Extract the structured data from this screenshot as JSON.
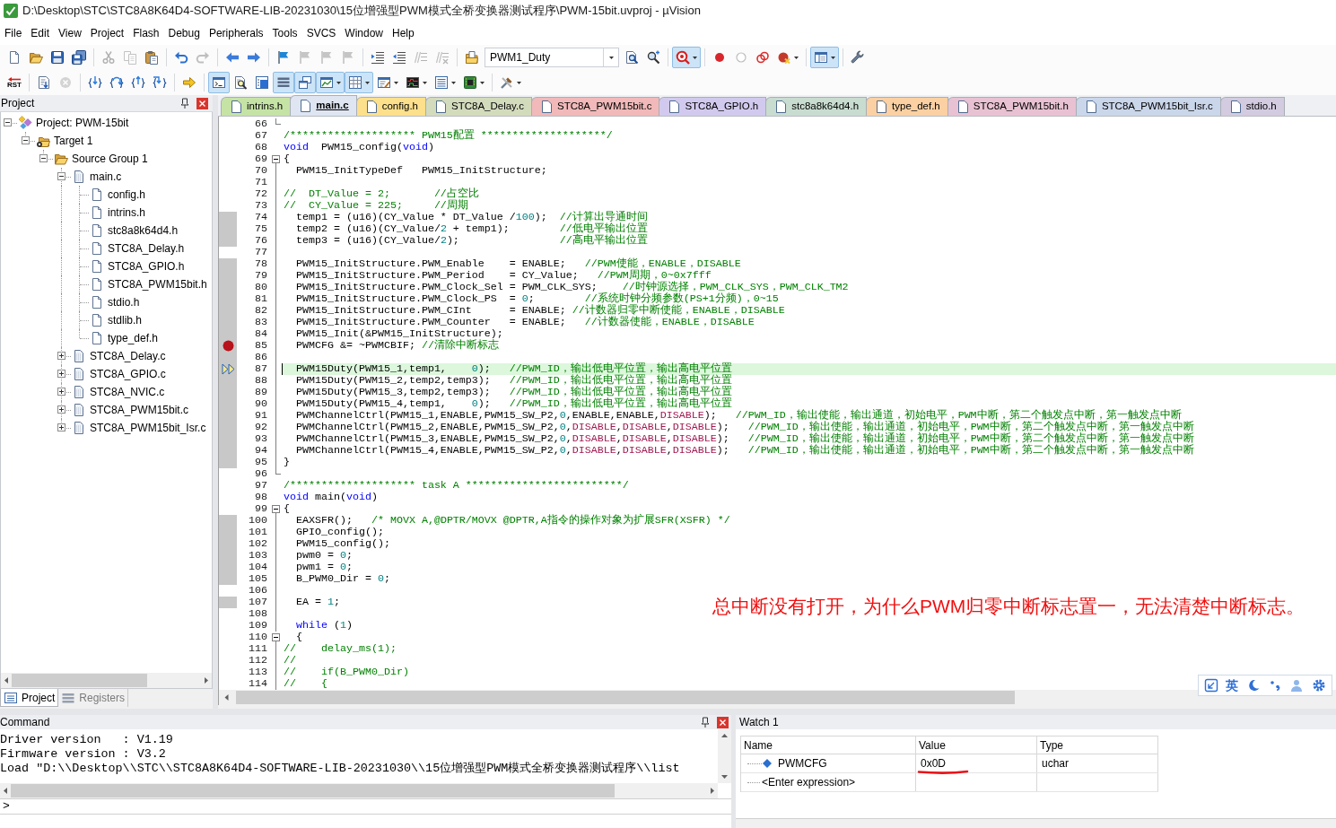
{
  "window": {
    "title": "D:\\Desktop\\STC\\STC8A8K64D4-SOFTWARE-LIB-20231030\\15位增强型PWM模式全桥变换器测试程序\\PWM-15bit.uvproj - µVision"
  },
  "menu": [
    "File",
    "Edit",
    "View",
    "Project",
    "Flash",
    "Debug",
    "Peripherals",
    "Tools",
    "SVCS",
    "Window",
    "Help"
  ],
  "toolbars": [
    {
      "groups": [
        [
          {
            "kind": "button",
            "pressed": false,
            "disabled": false,
            "dropdown": false
          },
          {
            "kind": "button",
            "pressed": false,
            "disabled": false,
            "dropdown": false
          },
          {
            "kind": "button",
            "pressed": false,
            "disabled": false,
            "dropdown": false
          },
          {
            "kind": "button",
            "pressed": false,
            "disabled": false,
            "dropdown": false
          }
        ],
        [
          {
            "kind": "button",
            "pressed": false,
            "disabled": true,
            "dropdown": false
          },
          {
            "kind": "button",
            "pressed": false,
            "disabled": true,
            "dropdown": false
          },
          {
            "kind": "button",
            "pressed": false,
            "disabled": false,
            "dropdown": false
          }
        ],
        [
          {
            "kind": "button",
            "pressed": false,
            "disabled": false,
            "dropdown": false
          },
          {
            "kind": "button",
            "pressed": false,
            "disabled": true,
            "dropdown": false
          }
        ],
        [
          {
            "kind": "button",
            "pressed": false,
            "disabled": false,
            "dropdown": false
          },
          {
            "kind": "button",
            "pressed": false,
            "disabled": false,
            "dropdown": false
          }
        ],
        [
          {
            "kind": "button",
            "pressed": false,
            "disabled": false,
            "dropdown": false
          },
          {
            "kind": "button",
            "pressed": false,
            "disabled": true,
            "dropdown": false
          },
          {
            "kind": "button",
            "pressed": false,
            "disabled": true,
            "dropdown": false
          },
          {
            "kind": "button",
            "pressed": false,
            "disabled": true,
            "dropdown": false
          }
        ],
        [
          {
            "kind": "button",
            "pressed": false,
            "disabled": false,
            "dropdown": false
          },
          {
            "kind": "button",
            "pressed": false,
            "disabled": false,
            "dropdown": false
          },
          {
            "kind": "button",
            "pressed": false,
            "disabled": true,
            "dropdown": false
          },
          {
            "kind": "button",
            "pressed": false,
            "disabled": true,
            "dropdown": false
          }
        ],
        [
          {
            "kind": "button",
            "pressed": false,
            "disabled": false,
            "dropdown": false
          },
          {
            "kind": "combo",
            "value": "PWM1_Duty"
          },
          {
            "kind": "button",
            "pressed": false,
            "disabled": false,
            "dropdown": false
          },
          {
            "kind": "button",
            "pressed": false,
            "disabled": false,
            "dropdown": false
          }
        ],
        [
          {
            "kind": "button",
            "pressed": true,
            "disabled": false,
            "dropdown": true
          }
        ],
        [
          {
            "kind": "button",
            "pressed": false,
            "disabled": false,
            "dropdown": false
          },
          {
            "kind": "button",
            "pressed": false,
            "disabled": false,
            "dropdown": false
          },
          {
            "kind": "button",
            "pressed": false,
            "disabled": false,
            "dropdown": false
          },
          {
            "kind": "button",
            "pressed": false,
            "disabled": false,
            "dropdown": true
          }
        ],
        [
          {
            "kind": "button",
            "pressed": true,
            "disabled": false,
            "dropdown": true
          }
        ],
        [
          {
            "kind": "button",
            "pressed": false,
            "disabled": false,
            "dropdown": false
          }
        ]
      ]
    },
    {
      "groups": [
        [
          {
            "kind": "button",
            "label": "RST",
            "pressed": false,
            "disabled": false,
            "dropdown": false
          }
        ],
        [
          {
            "kind": "button",
            "pressed": false,
            "disabled": false,
            "dropdown": false
          },
          {
            "kind": "button",
            "pressed": false,
            "disabled": true,
            "dropdown": false
          }
        ],
        [
          {
            "kind": "button",
            "pressed": false,
            "disabled": false,
            "dropdown": false
          },
          {
            "kind": "button",
            "pressed": false,
            "disabled": false,
            "dropdown": false
          },
          {
            "kind": "button",
            "pressed": false,
            "disabled": false,
            "dropdown": false
          },
          {
            "kind": "button",
            "pressed": false,
            "disabled": false,
            "dropdown": false
          }
        ],
        [
          {
            "kind": "button",
            "pressed": false,
            "disabled": false,
            "dropdown": false
          }
        ],
        [
          {
            "kind": "button",
            "pressed": true,
            "disabled": false,
            "dropdown": false
          },
          {
            "kind": "button",
            "pressed": false,
            "disabled": false,
            "dropdown": false
          },
          {
            "kind": "button",
            "pressed": false,
            "disabled": false,
            "dropdown": false
          },
          {
            "kind": "button",
            "pressed": true,
            "disabled": false,
            "dropdown": false
          },
          {
            "kind": "button",
            "pressed": true,
            "disabled": false,
            "dropdown": false
          },
          {
            "kind": "button",
            "pressed": true,
            "disabled": false,
            "dropdown": true
          },
          {
            "kind": "button",
            "pressed": true,
            "disabled": false,
            "dropdown": true
          },
          {
            "kind": "button",
            "pressed": false,
            "disabled": false,
            "dropdown": true
          },
          {
            "kind": "button",
            "pressed": false,
            "disabled": false,
            "dropdown": true
          },
          {
            "kind": "button",
            "pressed": false,
            "disabled": false,
            "dropdown": true
          },
          {
            "kind": "button",
            "pressed": false,
            "disabled": false,
            "dropdown": true
          }
        ],
        [
          {
            "kind": "button",
            "pressed": false,
            "disabled": false,
            "dropdown": true
          }
        ]
      ]
    }
  ],
  "project_panel": {
    "title": "Project",
    "tree": [
      {
        "label": "Project: PWM-15bit",
        "kind": "project",
        "expanded": true,
        "children": [
          {
            "label": "Target 1",
            "kind": "target",
            "expanded": true,
            "children": [
              {
                "label": "Source Group 1",
                "kind": "group",
                "expanded": true,
                "children": [
                  {
                    "label": "main.c",
                    "kind": "source",
                    "expanded": true,
                    "children": [
                      {
                        "label": "config.h",
                        "kind": "header"
                      },
                      {
                        "label": "intrins.h",
                        "kind": "header"
                      },
                      {
                        "label": "stc8a8k64d4.h",
                        "kind": "header"
                      },
                      {
                        "label": "STC8A_Delay.h",
                        "kind": "header"
                      },
                      {
                        "label": "STC8A_GPIO.h",
                        "kind": "header"
                      },
                      {
                        "label": "STC8A_PWM15bit.h",
                        "kind": "header"
                      },
                      {
                        "label": "stdio.h",
                        "kind": "header"
                      },
                      {
                        "label": "stdlib.h",
                        "kind": "header"
                      },
                      {
                        "label": "type_def.h",
                        "kind": "header"
                      }
                    ]
                  },
                  {
                    "label": "STC8A_Delay.c",
                    "kind": "source",
                    "expanded": false
                  },
                  {
                    "label": "STC8A_GPIO.c",
                    "kind": "source",
                    "expanded": false
                  },
                  {
                    "label": "STC8A_NVIC.c",
                    "kind": "source",
                    "expanded": false
                  },
                  {
                    "label": "STC8A_PWM15bit.c",
                    "kind": "source",
                    "expanded": false
                  },
                  {
                    "label": "STC8A_PWM15bit_Isr.c",
                    "kind": "source",
                    "expanded": false
                  }
                ]
              }
            ]
          }
        ]
      }
    ],
    "tabs": [
      {
        "label": "Project",
        "selected": true
      },
      {
        "label": "Registers",
        "selected": false
      }
    ]
  },
  "editor": {
    "tabs": [
      {
        "label": "intrins.h",
        "color": "#c6e3a6",
        "selected": false
      },
      {
        "label": "main.c",
        "color": "#dfe6f2",
        "selected": true
      },
      {
        "label": "config.h",
        "color": "#fde08c",
        "selected": false
      },
      {
        "label": "STC8A_Delay.c",
        "color": "#d3dbbd",
        "selected": false
      },
      {
        "label": "STC8A_PWM15bit.c",
        "color": "#f1b9b9",
        "selected": false
      },
      {
        "label": "STC8A_GPIO.h",
        "color": "#d2caee",
        "selected": false
      },
      {
        "label": "stc8a8k64d4.h",
        "color": "#c8ddd0",
        "selected": false
      },
      {
        "label": "type_def.h",
        "color": "#fbd0a2",
        "selected": false
      },
      {
        "label": "STC8A_PWM15bit.h",
        "color": "#e8c2d2",
        "selected": false
      },
      {
        "label": "STC8A_PWM15bit_Isr.c",
        "color": "#cad6ea",
        "selected": false
      },
      {
        "label": "stdio.h",
        "color": "#d3cbe0",
        "selected": false
      }
    ],
    "lines": [
      {
        "number": "66",
        "kind": "end",
        "executable": false,
        "breakpoint": false,
        "current": false,
        "caret": false
      },
      {
        "number": "67",
        "kind": "plain",
        "executable": false,
        "breakpoint": false,
        "current": false,
        "caret": false,
        "code": [
          {
            "text": "/******************** PWM15配置 ********************/",
            "kind": "comment"
          }
        ]
      },
      {
        "number": "68",
        "kind": "plain",
        "executable": false,
        "breakpoint": false,
        "current": false,
        "caret": false,
        "code": [
          {
            "text": "void",
            "kind": "keyword"
          },
          {
            "text": "  PWM15_config(",
            "kind": "plain"
          },
          {
            "text": "void",
            "kind": "keyword"
          },
          {
            "text": ")",
            "kind": "plain"
          }
        ]
      },
      {
        "number": "69",
        "kind": "start",
        "executable": false,
        "breakpoint": false,
        "current": false,
        "caret": false,
        "code": [
          {
            "text": "{",
            "kind": "plain"
          }
        ]
      },
      {
        "number": "70",
        "kind": "body",
        "executable": false,
        "breakpoint": false,
        "current": false,
        "caret": false,
        "code": [
          {
            "text": "  PWM15_InitTypeDef   PWM15_InitStructure;",
            "kind": "plain"
          }
        ]
      },
      {
        "number": "71",
        "kind": "body",
        "executable": false,
        "breakpoint": false,
        "current": false,
        "caret": false
      },
      {
        "number": "72",
        "kind": "body",
        "executable": false,
        "breakpoint": false,
        "current": false,
        "caret": false,
        "code": [
          {
            "text": "//  DT_Value = 2;       //占空比",
            "kind": "comment"
          }
        ]
      },
      {
        "number": "73",
        "kind": "body",
        "executable": false,
        "breakpoint": false,
        "current": false,
        "caret": false,
        "code": [
          {
            "text": "//  CY_Value = 225;     //周期",
            "kind": "comment"
          }
        ]
      },
      {
        "number": "74",
        "kind": "body",
        "executable": true,
        "breakpoint": false,
        "current": false,
        "caret": false,
        "code": [
          {
            "text": "  temp1 = (u16)(CY_Value * DT_Value /",
            "kind": "plain"
          },
          {
            "text": "100",
            "kind": "number"
          },
          {
            "text": ");  ",
            "kind": "plain"
          },
          {
            "text": "//计算出导通时间",
            "kind": "comment"
          }
        ]
      },
      {
        "number": "75",
        "kind": "body",
        "executable": true,
        "breakpoint": false,
        "current": false,
        "caret": false,
        "code": [
          {
            "text": "  temp2 = (u16)(CY_Value/",
            "kind": "plain"
          },
          {
            "text": "2",
            "kind": "number"
          },
          {
            "text": " + temp1);        ",
            "kind": "plain"
          },
          {
            "text": "//低电平输出位置",
            "kind": "comment"
          }
        ]
      },
      {
        "number": "76",
        "kind": "body",
        "executable": true,
        "breakpoint": false,
        "current": false,
        "caret": false,
        "code": [
          {
            "text": "  temp3 = (u16)(CY_Value/",
            "kind": "plain"
          },
          {
            "text": "2",
            "kind": "number"
          },
          {
            "text": ");                ",
            "kind": "plain"
          },
          {
            "text": "//高电平输出位置",
            "kind": "comment"
          }
        ]
      },
      {
        "number": "77",
        "kind": "body",
        "executable": false,
        "breakpoint": false,
        "current": false,
        "caret": false
      },
      {
        "number": "78",
        "kind": "body",
        "executable": true,
        "breakpoint": false,
        "current": false,
        "caret": false,
        "code": [
          {
            "text": "  PWM15_InitStructure.PWM_Enable    = ENABLE;   ",
            "kind": "plain"
          },
          {
            "text": "//PWM使能，ENABLE，DISABLE",
            "kind": "comment"
          }
        ]
      },
      {
        "number": "79",
        "kind": "body",
        "executable": true,
        "breakpoint": false,
        "current": false,
        "caret": false,
        "code": [
          {
            "text": "  PWM15_InitStructure.PWM_Period    = CY_Value;   ",
            "kind": "plain"
          },
          {
            "text": "//PWM周期，0~0x7fff",
            "kind": "comment"
          }
        ]
      },
      {
        "number": "80",
        "kind": "body",
        "executable": true,
        "breakpoint": false,
        "current": false,
        "caret": false,
        "code": [
          {
            "text": "  PWM15_InitStructure.PWM_Clock_Sel = PWM_CLK_SYS;    ",
            "kind": "plain"
          },
          {
            "text": "//时钟源选择，PWM_CLK_SYS，PWM_CLK_TM2",
            "kind": "comment"
          }
        ]
      },
      {
        "number": "81",
        "kind": "body",
        "executable": true,
        "breakpoint": false,
        "current": false,
        "caret": false,
        "code": [
          {
            "text": "  PWM15_InitStructure.PWM_Clock_PS  = ",
            "kind": "plain"
          },
          {
            "text": "0",
            "kind": "number"
          },
          {
            "text": ";        ",
            "kind": "plain"
          },
          {
            "text": "//系统时钟分频参数(PS+1分频)，0~15",
            "kind": "comment"
          }
        ]
      },
      {
        "number": "82",
        "kind": "body",
        "executable": true,
        "breakpoint": false,
        "current": false,
        "caret": false,
        "code": [
          {
            "text": "  PWM15_InitStructure.PWM_CInt      = ENABLE; ",
            "kind": "plain"
          },
          {
            "text": "//计数器归零中断使能，ENABLE，DISABLE",
            "kind": "comment"
          }
        ]
      },
      {
        "number": "83",
        "kind": "body",
        "executable": true,
        "breakpoint": false,
        "current": false,
        "caret": false,
        "code": [
          {
            "text": "  PWM15_InitStructure.PWM_Counter   = ENABLE;   ",
            "kind": "plain"
          },
          {
            "text": "//计数器使能，ENABLE，DISABLE",
            "kind": "comment"
          }
        ]
      },
      {
        "number": "84",
        "kind": "body",
        "executable": true,
        "breakpoint": false,
        "current": false,
        "caret": false,
        "code": [
          {
            "text": "  PWM15_Init(&PWM15_InitStructure);",
            "kind": "plain"
          }
        ]
      },
      {
        "number": "85",
        "kind": "body",
        "executable": true,
        "breakpoint": true,
        "current": false,
        "caret": false,
        "code": [
          {
            "text": "  PWMCFG &= ~PWMCBIF; ",
            "kind": "plain"
          },
          {
            "text": "//清除中断标志",
            "kind": "comment"
          }
        ]
      },
      {
        "number": "86",
        "kind": "body",
        "executable": true,
        "breakpoint": false,
        "current": false,
        "caret": false
      },
      {
        "number": "87",
        "kind": "body",
        "executable": true,
        "breakpoint": false,
        "current": true,
        "caret": true,
        "code": [
          {
            "text": "  PWM15Duty(PWM15_1,temp1,    ",
            "kind": "plain"
          },
          {
            "text": "0",
            "kind": "number"
          },
          {
            "text": ");   ",
            "kind": "plain"
          },
          {
            "text": "//PWM_ID，输出低电平位置，输出高电平位置",
            "kind": "comment"
          }
        ]
      },
      {
        "number": "88",
        "kind": "body",
        "executable": true,
        "breakpoint": false,
        "current": false,
        "caret": false,
        "code": [
          {
            "text": "  PWM15Duty(PWM15_2,temp2,temp3);   ",
            "kind": "plain"
          },
          {
            "text": "//PWM_ID，输出低电平位置，输出高电平位置",
            "kind": "comment"
          }
        ]
      },
      {
        "number": "89",
        "kind": "body",
        "executable": true,
        "breakpoint": false,
        "current": false,
        "caret": false,
        "code": [
          {
            "text": "  PWM15Duty(PWM15_3,temp2,temp3);   ",
            "kind": "plain"
          },
          {
            "text": "//PWM_ID，输出低电平位置，输出高电平位置",
            "kind": "comment"
          }
        ]
      },
      {
        "number": "90",
        "kind": "body",
        "executable": true,
        "breakpoint": false,
        "current": false,
        "caret": false,
        "code": [
          {
            "text": "  PWM15Duty(PWM15_4,temp1,    ",
            "kind": "plain"
          },
          {
            "text": "0",
            "kind": "number"
          },
          {
            "text": ");   ",
            "kind": "plain"
          },
          {
            "text": "//PWM_ID，输出低电平位置，输出高电平位置",
            "kind": "comment"
          }
        ]
      },
      {
        "number": "91",
        "kind": "body",
        "executable": true,
        "breakpoint": false,
        "current": false,
        "caret": false,
        "code": [
          {
            "text": "  PWMChannelCtrl(PWM15_1,ENABLE,PWM15_SW_P2,",
            "kind": "plain"
          },
          {
            "text": "0",
            "kind": "number"
          },
          {
            "text": ",ENABLE,ENABLE,",
            "kind": "plain"
          },
          {
            "text": "DISABLE",
            "kind": "constant"
          },
          {
            "text": ");   ",
            "kind": "plain"
          },
          {
            "text": "//PWM_ID，输出使能，输出通道，初始电平，PWM中断，第二个触发点中断，第一触发点中断",
            "kind": "comment"
          }
        ]
      },
      {
        "number": "92",
        "kind": "body",
        "executable": true,
        "breakpoint": false,
        "current": false,
        "caret": false,
        "code": [
          {
            "text": "  PWMChannelCtrl(PWM15_2,ENABLE,PWM15_SW_P2,",
            "kind": "plain"
          },
          {
            "text": "0",
            "kind": "number"
          },
          {
            "text": ",",
            "kind": "plain"
          },
          {
            "text": "DISABLE",
            "kind": "constant"
          },
          {
            "text": ",",
            "kind": "plain"
          },
          {
            "text": "DISABLE",
            "kind": "constant"
          },
          {
            "text": ",",
            "kind": "plain"
          },
          {
            "text": "DISABLE",
            "kind": "constant"
          },
          {
            "text": ");   ",
            "kind": "plain"
          },
          {
            "text": "//PWM_ID，输出使能，输出通道，初始电平，PWM中断，第二个触发点中断，第一触发点中断",
            "kind": "comment"
          }
        ]
      },
      {
        "number": "93",
        "kind": "body",
        "executable": true,
        "breakpoint": false,
        "current": false,
        "caret": false,
        "code": [
          {
            "text": "  PWMChannelCtrl(PWM15_3,ENABLE,PWM15_SW_P2,",
            "kind": "plain"
          },
          {
            "text": "0",
            "kind": "number"
          },
          {
            "text": ",",
            "kind": "plain"
          },
          {
            "text": "DISABLE",
            "kind": "constant"
          },
          {
            "text": ",",
            "kind": "plain"
          },
          {
            "text": "DISABLE",
            "kind": "constant"
          },
          {
            "text": ",",
            "kind": "plain"
          },
          {
            "text": "DISABLE",
            "kind": "constant"
          },
          {
            "text": ");   ",
            "kind": "plain"
          },
          {
            "text": "//PWM_ID，输出使能，输出通道，初始电平，PWM中断，第二个触发点中断，第一触发点中断",
            "kind": "comment"
          }
        ]
      },
      {
        "number": "94",
        "kind": "body",
        "executable": true,
        "breakpoint": false,
        "current": false,
        "caret": false,
        "code": [
          {
            "text": "  PWMChannelCtrl(PWM15_4,ENABLE,PWM15_SW_P2,",
            "kind": "plain"
          },
          {
            "text": "0",
            "kind": "number"
          },
          {
            "text": ",",
            "kind": "plain"
          },
          {
            "text": "DISABLE",
            "kind": "constant"
          },
          {
            "text": ",",
            "kind": "plain"
          },
          {
            "text": "DISABLE",
            "kind": "constant"
          },
          {
            "text": ",",
            "kind": "plain"
          },
          {
            "text": "DISABLE",
            "kind": "constant"
          },
          {
            "text": ");   ",
            "kind": "plain"
          },
          {
            "text": "//PWM_ID，输出使能，输出通道，初始电平，PWM中断，第二个触发点中断，第一触发点中断",
            "kind": "comment"
          }
        ]
      },
      {
        "number": "95",
        "kind": "body",
        "executable": true,
        "breakpoint": false,
        "current": false,
        "caret": false,
        "code": [
          {
            "text": "}",
            "kind": "plain"
          }
        ]
      },
      {
        "number": "96",
        "kind": "end",
        "executable": false,
        "breakpoint": false,
        "current": false,
        "caret": false
      },
      {
        "number": "97",
        "kind": "plain",
        "executable": false,
        "breakpoint": false,
        "current": false,
        "caret": false,
        "code": [
          {
            "text": "/******************** task A *************************/",
            "kind": "comment"
          }
        ]
      },
      {
        "number": "98",
        "kind": "plain",
        "executable": false,
        "breakpoint": false,
        "current": false,
        "caret": false,
        "code": [
          {
            "text": "void",
            "kind": "keyword"
          },
          {
            "text": " main(",
            "kind": "plain"
          },
          {
            "text": "void",
            "kind": "keyword"
          },
          {
            "text": ")",
            "kind": "plain"
          }
        ]
      },
      {
        "number": "99",
        "kind": "start",
        "executable": false,
        "breakpoint": false,
        "current": false,
        "caret": false,
        "code": [
          {
            "text": "{",
            "kind": "plain"
          }
        ]
      },
      {
        "number": "100",
        "kind": "body",
        "executable": true,
        "breakpoint": false,
        "current": false,
        "caret": false,
        "code": [
          {
            "text": "  EAXSFR();   ",
            "kind": "plain"
          },
          {
            "text": "/* MOVX A,@DPTR/MOVX @DPTR,A指令的操作对象为扩展SFR(XSFR) */",
            "kind": "comment"
          }
        ]
      },
      {
        "number": "101",
        "kind": "body",
        "executable": true,
        "breakpoint": false,
        "current": false,
        "caret": false,
        "code": [
          {
            "text": "  GPIO_config();",
            "kind": "plain"
          }
        ]
      },
      {
        "number": "102",
        "kind": "body",
        "executable": true,
        "breakpoint": false,
        "current": false,
        "caret": false,
        "code": [
          {
            "text": "  PWM15_config();",
            "kind": "plain"
          }
        ]
      },
      {
        "number": "103",
        "kind": "body",
        "executable": true,
        "breakpoint": false,
        "current": false,
        "caret": false,
        "code": [
          {
            "text": "  pwm0 = ",
            "kind": "plain"
          },
          {
            "text": "0",
            "kind": "number"
          },
          {
            "text": ";",
            "kind": "plain"
          }
        ]
      },
      {
        "number": "104",
        "kind": "body",
        "executable": true,
        "breakpoint": false,
        "current": false,
        "caret": false,
        "code": [
          {
            "text": "  pwm1 = ",
            "kind": "plain"
          },
          {
            "text": "0",
            "kind": "number"
          },
          {
            "text": ";",
            "kind": "plain"
          }
        ]
      },
      {
        "number": "105",
        "kind": "body",
        "executable": true,
        "breakpoint": false,
        "current": false,
        "caret": false,
        "code": [
          {
            "text": "  B_PWM0_Dir = ",
            "kind": "plain"
          },
          {
            "text": "0",
            "kind": "number"
          },
          {
            "text": ";",
            "kind": "plain"
          }
        ]
      },
      {
        "number": "106",
        "kind": "body",
        "executable": false,
        "breakpoint": false,
        "current": false,
        "caret": false
      },
      {
        "number": "107",
        "kind": "body",
        "executable": true,
        "breakpoint": false,
        "current": false,
        "caret": false,
        "code": [
          {
            "text": "  EA = ",
            "kind": "plain"
          },
          {
            "text": "1",
            "kind": "number"
          },
          {
            "text": ";",
            "kind": "plain"
          }
        ]
      },
      {
        "number": "108",
        "kind": "body",
        "executable": false,
        "breakpoint": false,
        "current": false,
        "caret": false
      },
      {
        "number": "109",
        "kind": "body",
        "executable": false,
        "breakpoint": false,
        "current": false,
        "caret": false,
        "code": [
          {
            "text": "  while",
            "kind": "keyword"
          },
          {
            "text": " (",
            "kind": "plain"
          },
          {
            "text": "1",
            "kind": "number"
          },
          {
            "text": ")",
            "kind": "plain"
          }
        ]
      },
      {
        "number": "110",
        "kind": "start",
        "executable": false,
        "breakpoint": false,
        "current": false,
        "caret": false,
        "code": [
          {
            "text": "  {",
            "kind": "plain"
          }
        ]
      },
      {
        "number": "111",
        "kind": "body",
        "executable": false,
        "breakpoint": false,
        "current": false,
        "caret": false,
        "code": [
          {
            "text": "//    delay_ms(1);",
            "kind": "comment"
          }
        ]
      },
      {
        "number": "112",
        "kind": "body",
        "executable": false,
        "breakpoint": false,
        "current": false,
        "caret": false,
        "code": [
          {
            "text": "//",
            "kind": "comment"
          }
        ]
      },
      {
        "number": "113",
        "kind": "body",
        "executable": false,
        "breakpoint": false,
        "current": false,
        "caret": false,
        "code": [
          {
            "text": "//    if(B_PWM0_Dir)",
            "kind": "comment"
          }
        ]
      },
      {
        "number": "114",
        "kind": "body",
        "executable": false,
        "breakpoint": false,
        "current": false,
        "caret": false,
        "code": [
          {
            "text": "//    {",
            "kind": "comment"
          }
        ]
      }
    ]
  },
  "annotation": "总中断没有打开，为什么PWM归零中断标志置一，无法清楚中断标志。",
  "ime_toolbar": {
    "label": "英"
  },
  "command_panel": {
    "title": "Command",
    "lines": [
      "Driver version   : V1.19",
      "Firmware version : V3.2",
      "Load \"D:\\\\Desktop\\\\STC\\\\STC8A8K64D4-SOFTWARE-LIB-20231030\\\\15位增强型PWM模式全桥变换器测试程序\\\\list"
    ],
    "prompt": ">"
  },
  "watch_panel": {
    "title": "Watch 1",
    "columns": [
      "Name",
      "Value",
      "Type"
    ],
    "rows": [
      {
        "kind": "variable",
        "name": "PWMCFG",
        "value": "0x0D",
        "type": "uchar",
        "underlined": true
      },
      {
        "kind": "entry",
        "name": "<Enter expression>",
        "underlined": false
      }
    ]
  }
}
